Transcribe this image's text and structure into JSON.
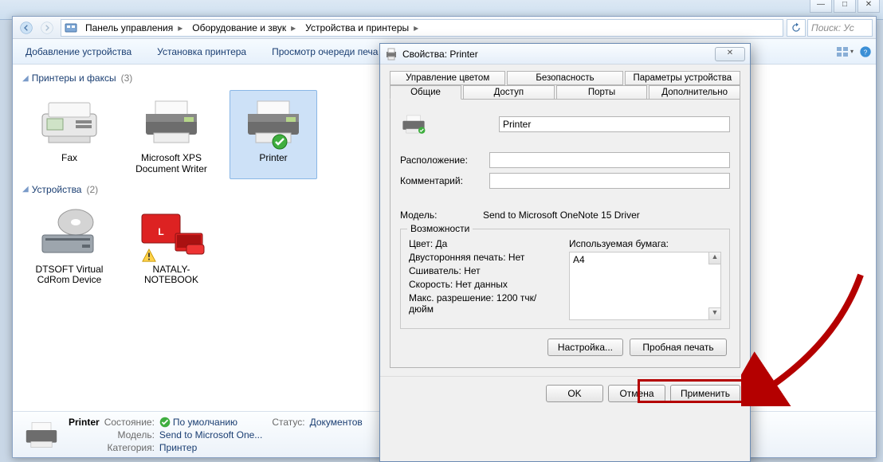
{
  "breadcrumbs": {
    "level1": "Панель управления",
    "level2": "Оборудование и звук",
    "level3": "Устройства и принтеры"
  },
  "search_placeholder": "Поиск: Ус",
  "toolbar": {
    "add_device": "Добавление устройства",
    "add_printer": "Установка принтера",
    "view_queue": "Просмотр очереди печа"
  },
  "groups": {
    "printers": {
      "title": "Принтеры и факсы",
      "count": "(3)"
    },
    "devices": {
      "title": "Устройства",
      "count": "(2)"
    }
  },
  "items": {
    "fax": "Fax",
    "xps": "Microsoft XPS Document Writer",
    "printer": "Printer",
    "dtsoft": "DTSOFT Virtual CdRom Device",
    "nataly": "NATALY-NOTEBOOK"
  },
  "details": {
    "name": "Printer",
    "state_label": "Состояние:",
    "state_value": "По умолчанию",
    "model_label": "Модель:",
    "model_value": "Send to Microsoft One...",
    "category_label": "Категория:",
    "category_value": "Принтер",
    "status_label": "Статус:",
    "status_value": "Документов"
  },
  "dialog": {
    "title": "Свойства: Printer",
    "tabs_top": {
      "color": "Управление цветом",
      "security": "Безопасность",
      "device": "Параметры устройства"
    },
    "tabs_bottom": {
      "general": "Общие",
      "sharing": "Доступ",
      "ports": "Порты",
      "advanced": "Дополнительно"
    },
    "fields": {
      "name_value": "Printer",
      "location_label": "Расположение:",
      "comment_label": "Комментарий:",
      "model_label": "Модель:",
      "model_value": "Send to Microsoft OneNote 15 Driver"
    },
    "features": {
      "legend": "Возможности",
      "color": "Цвет: Да",
      "duplex": "Двусторонняя печать: Нет",
      "staple": "Сшиватель: Нет",
      "speed": "Скорость: Нет данных",
      "maxres": "Макс. разрешение: 1200 тчк/дюйм",
      "paper_label": "Используемая бумага:",
      "paper_a4": "A4"
    },
    "buttons": {
      "preferences": "Настройка...",
      "test_page": "Пробная печать",
      "ok": "OK",
      "cancel": "Отмена",
      "apply": "Применить"
    }
  }
}
